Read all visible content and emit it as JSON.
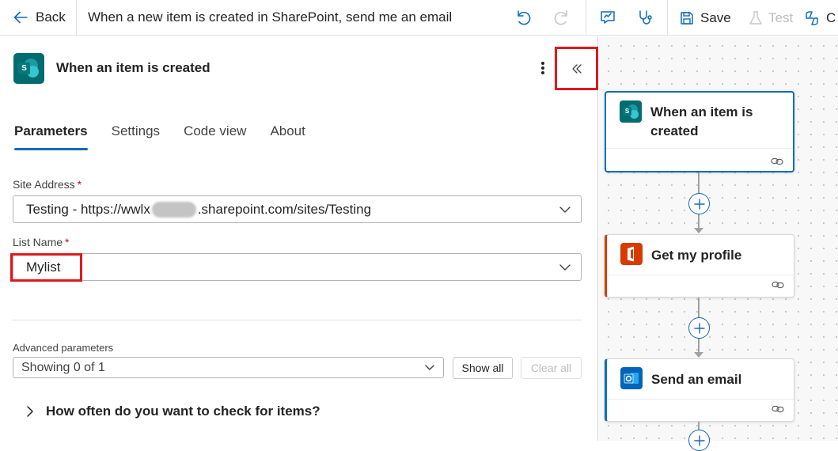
{
  "toolbar": {
    "back_label": "Back",
    "flow_title": "When a new item is created in SharePoint, send me an email",
    "undo_icon": "undo-icon",
    "redo_icon": "redo-icon",
    "flow_checker_icon": "flow-checker-icon",
    "stethoscope_icon": "stethoscope-icon",
    "save_label": "Save",
    "test_label": "Test",
    "copilot_partial_label": "C"
  },
  "panel": {
    "title": "When an item is created",
    "tabs": [
      {
        "label": "Parameters",
        "active": true
      },
      {
        "label": "Settings",
        "active": false
      },
      {
        "label": "Code view",
        "active": false
      },
      {
        "label": "About",
        "active": false
      }
    ],
    "site_address": {
      "label": "Site Address",
      "required_mark": "*",
      "value_prefix": "Testing - https://wwlx",
      "value_suffix": ".sharepoint.com/sites/Testing"
    },
    "list_name": {
      "label": "List Name",
      "required_mark": "*",
      "value": "Mylist"
    },
    "advanced": {
      "label": "Advanced parameters",
      "value": "Showing 0 of 1",
      "show_all_label": "Show all",
      "clear_all_label": "Clear all"
    },
    "accordion_label": "How often do you want to check for items?"
  },
  "canvas": {
    "cards": [
      {
        "title": "When an item is created",
        "icon": "sharepoint-icon",
        "accent": "#0f6cbd"
      },
      {
        "title": "Get my profile",
        "icon": "office365-icon",
        "accent": "#d83b01"
      },
      {
        "title": "Send an email",
        "icon": "outlook-icon",
        "accent": "#0f6cbd"
      }
    ]
  },
  "colors": {
    "accent_blue": "#0f6cbd",
    "highlight_red": "#e0181d",
    "sharepoint_teal": "#036c70",
    "office_orange": "#d83b01",
    "outlook_blue": "#0364b8"
  }
}
